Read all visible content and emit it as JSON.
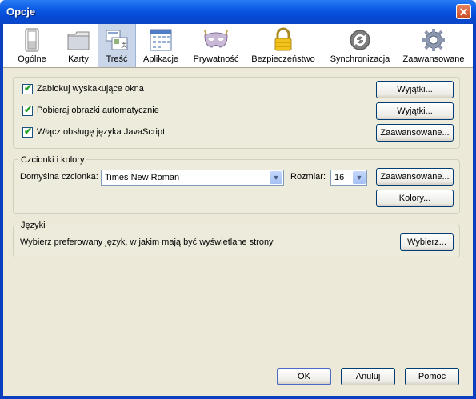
{
  "window": {
    "title": "Opcje",
    "close_glyph": "✕"
  },
  "toolbar": {
    "tabs": [
      {
        "label": "Ogólne",
        "icon": "switch-icon"
      },
      {
        "label": "Karty",
        "icon": "folder-icon"
      },
      {
        "label": "Treść",
        "icon": "content-icon",
        "selected": true
      },
      {
        "label": "Aplikacje",
        "icon": "applications-icon"
      },
      {
        "label": "Prywatność",
        "icon": "mask-icon"
      },
      {
        "label": "Bezpieczeństwo",
        "icon": "lock-icon"
      },
      {
        "label": "Synchronizacja",
        "icon": "sync-icon"
      },
      {
        "label": "Zaawansowane",
        "icon": "gear-icon"
      }
    ]
  },
  "content": {
    "block_popups": {
      "label": "Zablokuj wyskakujące okna",
      "checked": true,
      "button": "Wyjątki..."
    },
    "load_images": {
      "label": "Pobieraj obrazki automatycznie",
      "checked": true,
      "button": "Wyjątki..."
    },
    "javascript": {
      "label": "Włącz obsługę języka JavaScript",
      "checked": true,
      "button": "Zaawansowane..."
    }
  },
  "fonts": {
    "legend": "Czcionki i kolory",
    "default_font_label": "Domyślna czcionka:",
    "default_font_value": "Times New Roman",
    "size_label": "Rozmiar:",
    "size_value": "16",
    "advanced_button": "Zaawansowane...",
    "colors_button": "Kolory..."
  },
  "languages": {
    "legend": "Języki",
    "description": "Wybierz preferowany język, w jakim mają być wyświetlane strony",
    "choose_button": "Wybierz..."
  },
  "footer": {
    "ok": "OK",
    "cancel": "Anuluj",
    "help": "Pomoc"
  }
}
